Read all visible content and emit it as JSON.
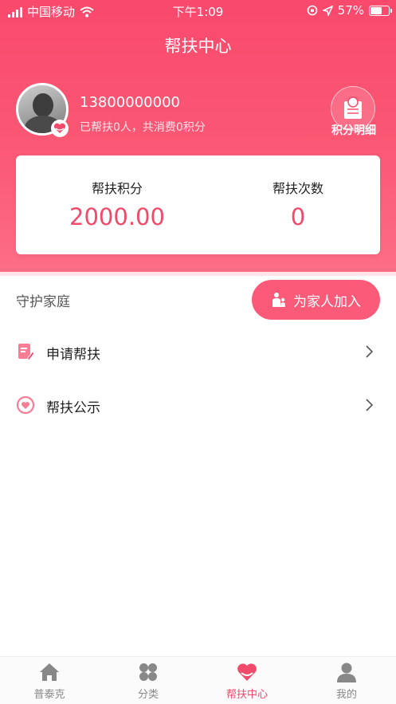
{
  "status_bar": {
    "carrier": "中国移动",
    "time": "下午1:09",
    "battery": "57%",
    "battery_level": 0.57
  },
  "nav": {
    "title": "帮扶中心"
  },
  "profile": {
    "phone": "13800000000",
    "summary": "已帮扶0人，共消费0积分",
    "points_detail_label": "积分明细"
  },
  "stats": [
    {
      "label": "帮扶积分",
      "value": "2000.00"
    },
    {
      "label": "帮扶次数",
      "value": "0"
    }
  ],
  "guard": {
    "label": "守护家庭",
    "join_button": "为家人加入"
  },
  "menu": [
    {
      "label": "申请帮扶",
      "icon": "edit-document-icon"
    },
    {
      "label": "帮扶公示",
      "icon": "heart-circle-icon"
    }
  ],
  "tabs": [
    {
      "label": "普泰克",
      "icon": "home-icon",
      "active": false
    },
    {
      "label": "分类",
      "icon": "grid-icon",
      "active": false
    },
    {
      "label": "帮扶中心",
      "icon": "heart-icon",
      "active": true
    },
    {
      "label": "我的",
      "icon": "user-icon",
      "active": false
    }
  ],
  "colors": {
    "accent": "#f24a6b",
    "header": "#f9496c",
    "inactive": "#888888"
  }
}
